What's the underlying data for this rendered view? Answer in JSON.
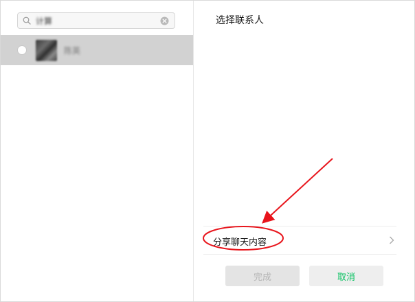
{
  "search": {
    "value": "计算",
    "icon": "search-icon",
    "clear_icon": "clear-icon"
  },
  "contacts": [
    {
      "name": "陈英",
      "selected": false
    }
  ],
  "right_panel": {
    "title": "选择联系人"
  },
  "share_option": {
    "label": "分享聊天内容",
    "icon": "chevron-right-icon"
  },
  "buttons": {
    "done": "完成",
    "cancel": "取消"
  },
  "colors": {
    "accent_green": "#07c160",
    "selected_row": "#d2d2d2",
    "annotation_red": "#e8141b"
  }
}
